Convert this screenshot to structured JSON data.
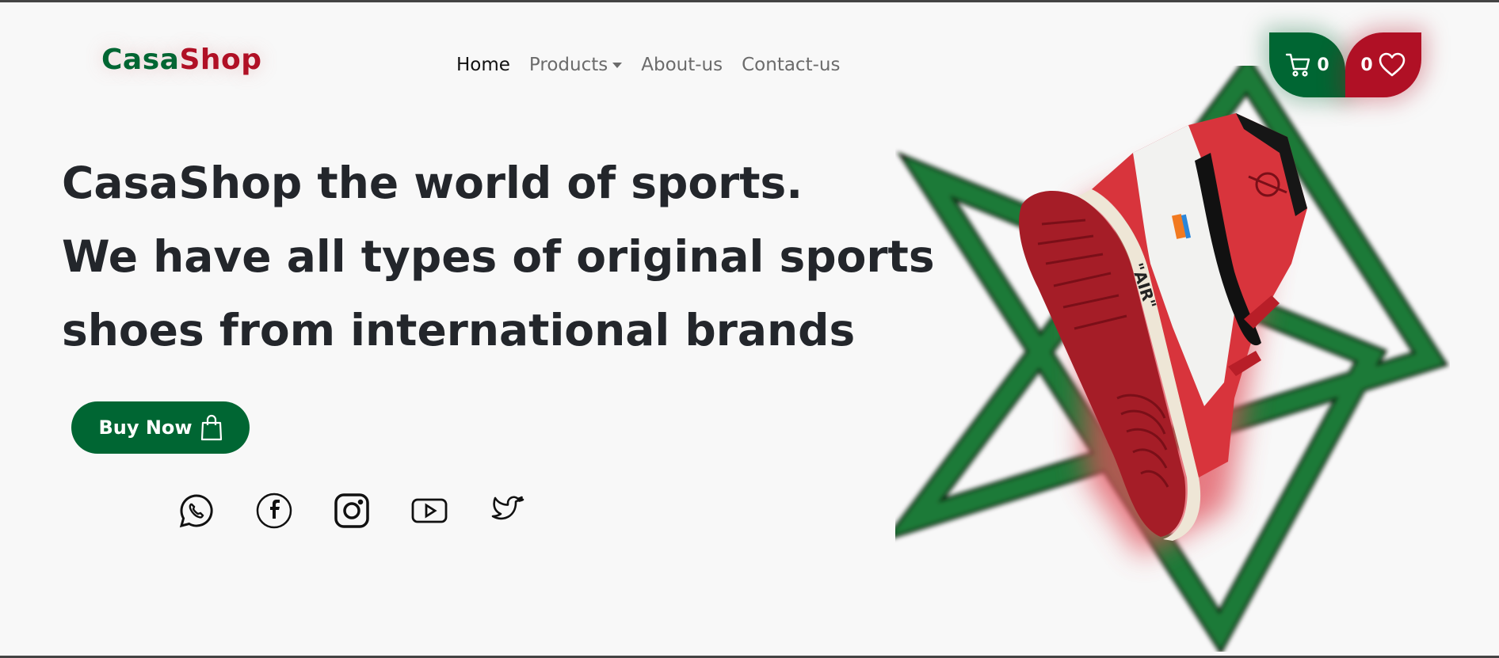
{
  "brand": {
    "part1": "Casa",
    "part2": "Shop"
  },
  "nav": {
    "home": "Home",
    "products": "Products",
    "about": "About-us",
    "contact": "Contact-us"
  },
  "cart": {
    "count": "0"
  },
  "wishlist": {
    "count": "0"
  },
  "hero": {
    "line1": "CasaShop the world of sports.",
    "line2": "We have all types of original sports",
    "line3": "shoes from international brands",
    "buy_label": "Buy Now",
    "shoe_text": "\"AIR\""
  },
  "social": [
    "whatsapp-icon",
    "facebook-icon",
    "instagram-icon",
    "youtube-icon",
    "twitter-icon"
  ],
  "colors": {
    "green": "#006633",
    "red": "#b01025",
    "background": "#f8f8f8"
  }
}
